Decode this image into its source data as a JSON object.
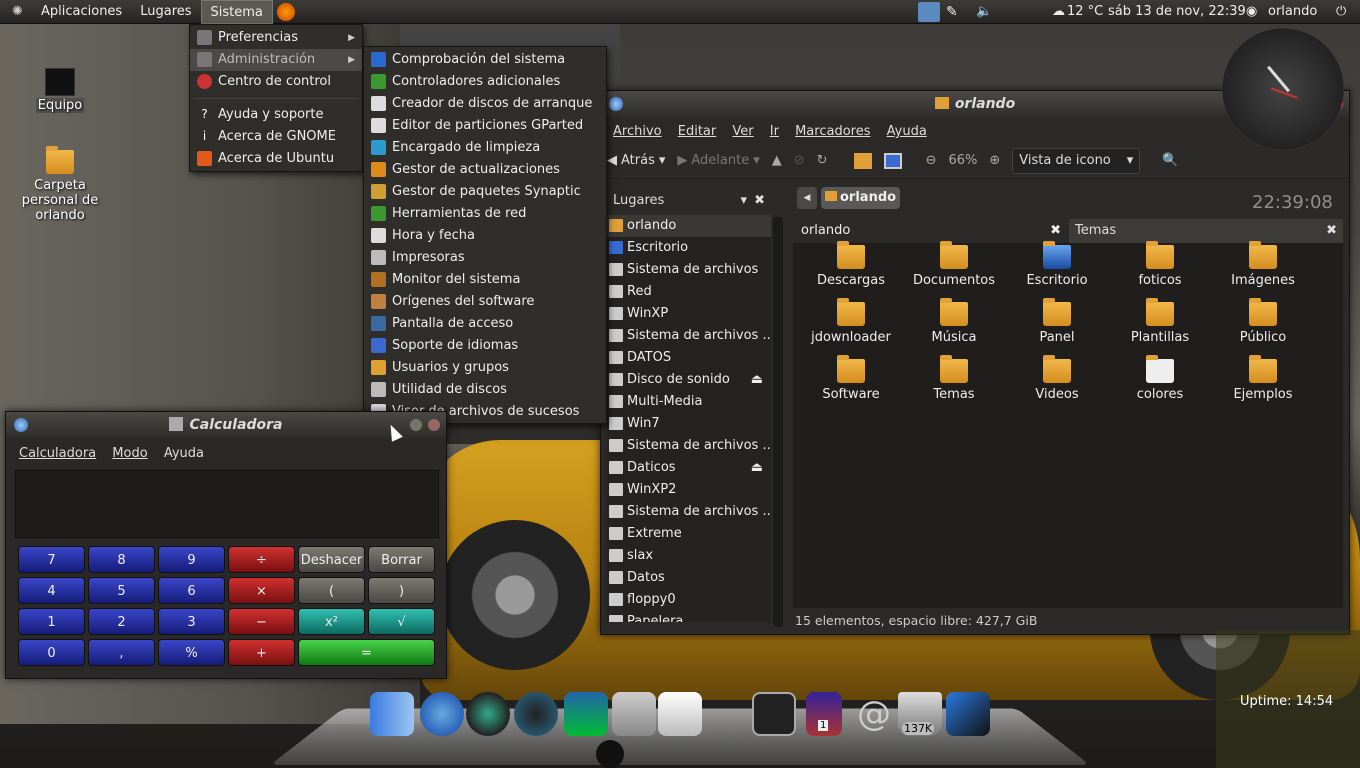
{
  "panel": {
    "menus": [
      "Aplicaciones",
      "Lugares",
      "Sistema"
    ],
    "weather": "12 °C",
    "datetime": "sáb 13 de nov, 22:39",
    "user": "orlando"
  },
  "sistema_menu": {
    "items": [
      {
        "label": "Preferencias",
        "submenu": true,
        "color": "#777"
      },
      {
        "label": "Administración",
        "submenu": true,
        "color": "#777"
      },
      {
        "label": "Centro de control",
        "color": "#d33"
      },
      {
        "label": "Ayuda y soporte",
        "color": "#333"
      },
      {
        "label": "Acerca de GNOME",
        "color": "#333"
      },
      {
        "label": "Acerca de Ubuntu",
        "color": "#e05a1a"
      }
    ]
  },
  "admin_menu": {
    "items": [
      {
        "label": "Comprobación del sistema",
        "color": "#2a6ad0"
      },
      {
        "label": "Controladores adicionales",
        "color": "#3a9a30"
      },
      {
        "label": "Creador de discos de arranque",
        "color": "#ddd"
      },
      {
        "label": "Editor de particiones GParted",
        "color": "#ddd"
      },
      {
        "label": "Encargado de limpieza",
        "color": "#2a9ad0"
      },
      {
        "label": "Gestor de actualizaciones",
        "color": "#e08a1a"
      },
      {
        "label": "Gestor de paquetes Synaptic",
        "color": "#d0a030"
      },
      {
        "label": "Herramientas de red",
        "color": "#3a9a30"
      },
      {
        "label": "Hora y fecha",
        "color": "#ddd"
      },
      {
        "label": "Impresoras",
        "color": "#bbb"
      },
      {
        "label": "Monitor del sistema",
        "color": "#b07020"
      },
      {
        "label": "Orígenes del software",
        "color": "#c08040"
      },
      {
        "label": "Pantalla de acceso",
        "color": "#3a6aa0"
      },
      {
        "label": "Soporte de idiomas",
        "color": "#3a6ad0"
      },
      {
        "label": "Usuarios y grupos",
        "color": "#e0a030"
      },
      {
        "label": "Utilidad de discos",
        "color": "#bbb"
      },
      {
        "label": "Visor de archivos de sucesos",
        "color": "#ddd"
      }
    ]
  },
  "desktop": {
    "equipo": "Equipo",
    "home": "Carpeta personal de orlando"
  },
  "nautilus": {
    "title": "orlando",
    "menus": [
      "Archivo",
      "Editar",
      "Ver",
      "Ir",
      "Marcadores",
      "Ayuda"
    ],
    "back": "Atrás",
    "forward": "Adelante",
    "zoom": "66%",
    "view": "Vista de icono",
    "places_title": "Lugares",
    "path": "orlando",
    "tabs": [
      "orlando",
      "Temas"
    ],
    "places": [
      "orlando",
      "Escritorio",
      "Sistema de archivos",
      "Red",
      "WinXP",
      "Sistema de archivos ...",
      "DATOS",
      "Disco de sonido",
      "Multi-Media",
      "Win7",
      "Sistema de archivos ...",
      "Daticos",
      "WinXP2",
      "Sistema de archivos ...",
      "Extreme",
      "slax",
      "Datos",
      "floppy0",
      "Papelera"
    ],
    "files": [
      "Descargas",
      "Documentos",
      "Escritorio",
      "foticos",
      "Imágenes",
      "jdownloader",
      "Música",
      "Panel",
      "Plantillas",
      "Público",
      "Software",
      "Temas",
      "Videos",
      "colores",
      "Ejemplos"
    ],
    "status": "15 elementos, espacio libre: 427,7 GiB"
  },
  "calc": {
    "title": "Calculadora",
    "menus": [
      "Calculadora",
      "Modo",
      "Ayuda"
    ],
    "keys": [
      "7",
      "8",
      "9",
      "÷",
      "Deshacer",
      "Borrar",
      "4",
      "5",
      "6",
      "×",
      "(",
      ")",
      "1",
      "2",
      "3",
      "−",
      "x²",
      "√",
      "0",
      ",",
      "%",
      "+",
      "="
    ]
  },
  "widgets": {
    "clock_digital": "22:39:08",
    "uptime": "Uptime: 14:54",
    "trash_size": "137K",
    "badge": "1"
  }
}
